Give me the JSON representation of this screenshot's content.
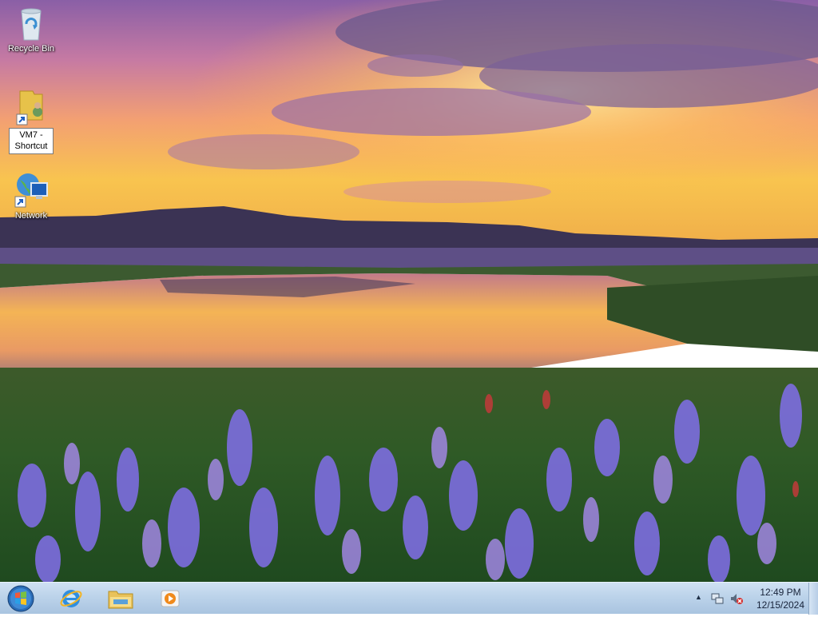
{
  "desktop": {
    "icons": [
      {
        "label": "Recycle Bin",
        "icon": "recycle-bin-icon"
      },
      {
        "label": "VM7 - Shortcut",
        "icon": "folder-shortcut-icon",
        "selected": true
      },
      {
        "label": "Network",
        "icon": "network-icon"
      }
    ]
  },
  "taskbar": {
    "start": {
      "icon": "windows-start-orb-icon"
    },
    "pinned": [
      {
        "name": "Internet Explorer",
        "icon": "internet-explorer-icon"
      },
      {
        "name": "File Explorer",
        "icon": "file-explorer-icon"
      },
      {
        "name": "Media Player",
        "icon": "media-player-icon"
      }
    ],
    "tray": {
      "show_hidden_icon": "▲",
      "network_icon": "network-tray-icon",
      "volume_icon": "volume-muted-icon",
      "time": "12:49 PM",
      "date": "12/15/2024"
    }
  },
  "colors": {
    "taskbar": "#bcd3ea",
    "label_text": "#ffffff"
  }
}
